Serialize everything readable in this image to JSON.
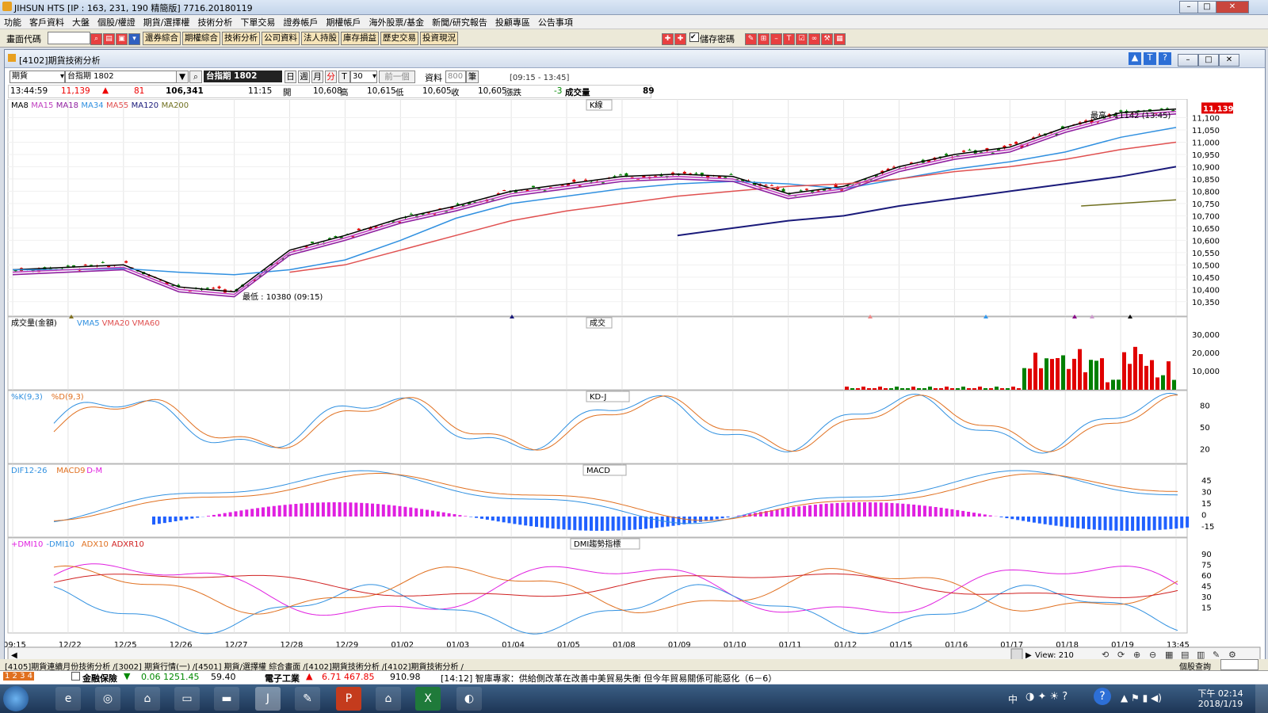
{
  "window": {
    "title": "JIHSUN HTS    [IP : 163, 231, 190 精簡版] 7716.20180119"
  },
  "menu": [
    "功能",
    "客戶資料",
    "大盤",
    "個股/權證",
    "期貨/選擇權",
    "技術分析",
    "下單交易",
    "證券帳戶",
    "期權帳戶",
    "海外股票/基金",
    "新聞/研究報告",
    "投顧專區",
    "公告事項"
  ],
  "toolbar": {
    "code_label": "畫面代碼",
    "buttons": [
      "還券綜合",
      "期權綜合",
      "技術分析",
      "公司資料",
      "法人持股",
      "庫存損益",
      "歷史交易",
      "投資現況"
    ],
    "save_pw": "儲存密碼"
  },
  "chartwindow": {
    "title": "[4102]期貨技術分析",
    "market": "期貨",
    "contract": "台指期 1802",
    "contract_name": "台指期 1802",
    "period_buttons": [
      "日",
      "週",
      "月",
      "分",
      "T"
    ],
    "minutes": "30",
    "prev": "前一個",
    "data_label": "資料",
    "data_count": "800",
    "data_unit": "筆",
    "session": "[09:15 - 13:45]"
  },
  "quote": {
    "time": "13:44:59",
    "last": "11,139",
    "change": "81",
    "volume_total": "106,341",
    "bar_time": "11:15",
    "open_label": "開",
    "open": "10,608",
    "high_label": "高",
    "high": "10,615",
    "low_label": "低",
    "low": "10,605",
    "close_label": "收",
    "close": "10,605",
    "chg_label": "漲跌",
    "chg": "-3",
    "vol_label": "成交量",
    "vol": "89"
  },
  "panels": {
    "k": {
      "title": "K線",
      "legend": [
        "MA8",
        "MA15",
        "MA18",
        "MA34",
        "MA55",
        "MA120",
        "MA200"
      ],
      "legend_colors": [
        "#000000",
        "#c040c0",
        "#9020a0",
        "#3090e0",
        "#e05050",
        "#1a1a7a",
        "#707020"
      ],
      "high_note": "最高 : 11142 (13:45)",
      "low_note": "最低 : 10380 (09:15)",
      "last_tag": "11,139",
      "yticks": [
        "11,100",
        "11,050",
        "11,000",
        "10,950",
        "10,900",
        "10,850",
        "10,800",
        "10,750",
        "10,700",
        "10,650",
        "10,600",
        "10,550",
        "10,500",
        "10,450",
        "10,400",
        "10,350"
      ]
    },
    "vol": {
      "title": "成交",
      "legend": [
        "成交量(金額)",
        "VMA5",
        "VMA20",
        "VMA60"
      ],
      "yticks": [
        "30,000",
        "20,000",
        "10,000"
      ]
    },
    "kd": {
      "title": "KD-J",
      "legend": [
        "%K(9,3)",
        "%D(9,3)"
      ],
      "yticks": [
        "80",
        "50",
        "20"
      ]
    },
    "macd": {
      "title": "MACD",
      "legend": [
        "DIF12-26",
        "MACD9",
        "D-M"
      ],
      "yticks": [
        "45",
        "30",
        "15",
        "0",
        "-15"
      ]
    },
    "dmi": {
      "title": "DMI趨勢指標",
      "legend": [
        "+DMI10",
        "-DMI10",
        "ADX10",
        "ADXR10"
      ],
      "yticks": [
        "90",
        "75",
        "60",
        "45",
        "30",
        "15"
      ]
    }
  },
  "xaxis": [
    "09:15",
    "12/22",
    "12/25",
    "12/26",
    "12/27",
    "12/28",
    "12/29",
    "01/02",
    "01/03",
    "01/04",
    "01/05",
    "01/08",
    "01/09",
    "01/10",
    "01/11",
    "01/12",
    "01/15",
    "01/16",
    "01/17",
    "01/18",
    "01/19",
    "13:45"
  ],
  "view_label": "View: 210",
  "tabs": [
    "[4105]期貨連續月份技術分析",
    "[3002] 期貨行情(一)",
    "[4501] 期貨/選擇權 綜合畫面",
    "[4102]期貨技術分析",
    "[4102]期貨技術分析"
  ],
  "tab_right": "個股查詢",
  "ticker": {
    "a": "金融保險",
    "a_val": "0.06 1251.45",
    "a2": "59.40",
    "b": "電子工業",
    "b_val": "6.71 467.85",
    "b2": "910.98",
    "news": "[14:12] 智庫專家：供給側改革在改善中美貿易失衡 但今年貿易關係可能惡化（6－6）"
  },
  "clock": {
    "time": "下午 02:14",
    "date": "2018/1/19",
    "lang": "中"
  },
  "chart_data": {
    "type": "line",
    "title": "",
    "x": [
      "09:15",
      "12/22",
      "12/25",
      "12/26",
      "12/27",
      "12/28",
      "12/29",
      "01/02",
      "01/03",
      "01/04",
      "01/05",
      "01/08",
      "01/09",
      "01/10",
      "01/11",
      "01/12",
      "01/15",
      "01/16",
      "01/17",
      "01/18",
      "01/19",
      "13:45"
    ],
    "ylim": [
      10330,
      11150
    ],
    "series": [
      {
        "name": "MA8",
        "values": [
          10480,
          10490,
          10500,
          10410,
          10390,
          10560,
          10620,
          10690,
          10740,
          10800,
          10830,
          10860,
          10870,
          10860,
          10790,
          10820,
          10900,
          10950,
          10980,
          11060,
          11120,
          11135
        ]
      },
      {
        "name": "MA34",
        "values": [
          10480,
          10480,
          10485,
          10470,
          10460,
          10480,
          10520,
          10600,
          10690,
          10750,
          10780,
          10810,
          10830,
          10840,
          10830,
          10810,
          10850,
          10890,
          10920,
          10960,
          11020,
          11060
        ]
      },
      {
        "name": "MA55",
        "values": [
          null,
          null,
          null,
          null,
          null,
          10470,
          10500,
          10560,
          10620,
          10680,
          10720,
          10750,
          10780,
          10800,
          10820,
          10830,
          10850,
          10880,
          10900,
          10930,
          10970,
          11000
        ]
      },
      {
        "name": "MA120",
        "values": [
          null,
          null,
          null,
          null,
          null,
          null,
          null,
          null,
          null,
          null,
          null,
          null,
          10620,
          10650,
          10680,
          10700,
          10740,
          10770,
          10800,
          10830,
          10860,
          10900
        ]
      }
    ]
  }
}
